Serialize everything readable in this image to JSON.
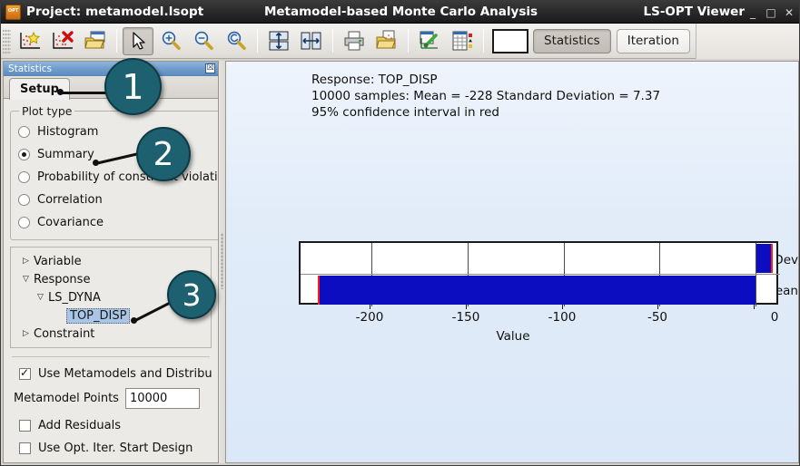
{
  "window": {
    "app_icon": "lsopt-logo-icon",
    "project_label": "Project: metamodel.lsopt",
    "center_title": "Metamodel-based Monte Carlo Analysis",
    "app_name": "LS-OPT Viewer",
    "controls": {
      "minimize": "_",
      "maximize": "□",
      "close": "✕"
    }
  },
  "toolbar": {
    "buttons": [
      {
        "name": "add-plot-icon",
        "title": "Add Plot"
      },
      {
        "name": "delete-plot-icon",
        "title": "Delete Plot"
      },
      {
        "name": "open-folder-icon",
        "title": "Open"
      },
      {
        "name": "pointer-tool-icon",
        "title": "Select",
        "pressed": true
      },
      {
        "name": "zoom-in-icon",
        "title": "Zoom In"
      },
      {
        "name": "zoom-out-icon",
        "title": "Zoom Out"
      },
      {
        "name": "zoom-reset-icon",
        "title": "Reset Zoom"
      },
      {
        "name": "fit-vertical-icon",
        "title": "Fit Vertical"
      },
      {
        "name": "fit-horizontal-icon",
        "title": "Fit Horizontal"
      },
      {
        "name": "print-icon",
        "title": "Print"
      },
      {
        "name": "export-icon",
        "title": "Export"
      },
      {
        "name": "plot-settings-icon",
        "title": "Plot Settings"
      },
      {
        "name": "data-table-icon",
        "title": "Data Table"
      }
    ],
    "mode_swatch": "plot-preview-swatch",
    "modes": [
      {
        "label": "Statistics",
        "active": true
      },
      {
        "label": "Iteration",
        "active": false
      }
    ]
  },
  "statistics_panel": {
    "header_title": "Statistics",
    "close_glyph": "☒",
    "tab_label": "Setup",
    "plot_type": {
      "legend": "Plot type",
      "options": [
        {
          "label": "Histogram",
          "selected": false
        },
        {
          "label": "Summary",
          "selected": true
        },
        {
          "label": "Probability of constraint violation",
          "selected": false
        },
        {
          "label": "Correlation",
          "selected": false
        },
        {
          "label": "Covariance",
          "selected": false
        }
      ]
    },
    "tree": [
      {
        "label": "Variable",
        "indent": 0,
        "arrow": "▷",
        "selected": false
      },
      {
        "label": "Response",
        "indent": 0,
        "arrow": "▽",
        "selected": false
      },
      {
        "label": "LS_DYNA",
        "indent": 1,
        "arrow": "▽",
        "selected": false
      },
      {
        "label": "TOP_DISP",
        "indent": 2,
        "arrow": "",
        "selected": true
      },
      {
        "label": "Constraint",
        "indent": 0,
        "arrow": "▷",
        "selected": false
      }
    ],
    "use_metamodels": {
      "label": "Use Metamodels and Distributions",
      "checked": true
    },
    "metamodel_points": {
      "label": "Metamodel Points",
      "value": "10000"
    },
    "add_residuals": {
      "label": "Add Residuals",
      "checked": false
    },
    "use_opt_iter_start": {
      "label": "Use Opt. Iter. Start Design",
      "checked": false
    }
  },
  "plot": {
    "title_lines": [
      "Response: TOP_DISP",
      "10000 samples: Mean = -228   Standard Deviation = 7.37",
      "95% confidence interval in red"
    ]
  },
  "chart_data": {
    "type": "bar",
    "orientation": "horizontal",
    "title": "Response: TOP_DISP",
    "subtitle": "10000 samples: Mean = -228   Standard Deviation = 7.37",
    "note": "95% confidence interval in red",
    "categories": [
      "Std Dev",
      "Mean"
    ],
    "values": [
      7.37,
      -228
    ],
    "bar_colors": [
      "#0c0cc0",
      "#0c0cc0"
    ],
    "ci_color": "#ff1a1a",
    "confidence_level": "95%",
    "ci_bounds": [
      [
        7.2,
        7.55
      ],
      [
        -228.4,
        -227.6
      ]
    ],
    "xlabel": "Value",
    "ylabel": "",
    "xlim": [
      -239,
      11
    ],
    "xticks": [
      -200,
      -150,
      -100,
      -50,
      0
    ],
    "xticklabels": [
      "-200",
      "-150",
      "-100",
      "-50",
      "0"
    ],
    "grid": true,
    "legend": false,
    "samples": 10000,
    "mean": -228,
    "std_dev": 7.37
  },
  "callouts": [
    {
      "number": "1",
      "target": "setup-tab"
    },
    {
      "number": "2",
      "target": "summary-radio"
    },
    {
      "number": "3",
      "target": "tree-item-top-disp"
    }
  ]
}
